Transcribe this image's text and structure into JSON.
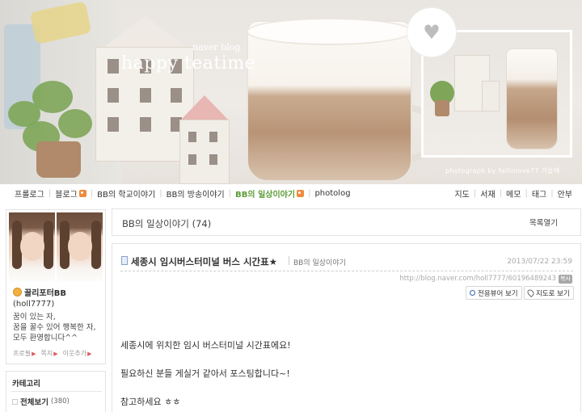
{
  "banner": {
    "subtitle": "naver blog",
    "title": "happy teatime",
    "photo_credit": "photograph by fallinlove77.가을애",
    "heart_icon": "heart-icon"
  },
  "nav": {
    "left": [
      {
        "label": "프롤로그",
        "rss": false,
        "active": false
      },
      {
        "label": "블로그",
        "rss": true,
        "active": false
      },
      {
        "label": "BB의 학교이야기",
        "rss": false,
        "active": false
      },
      {
        "label": "BB의 방송이야기",
        "rss": false,
        "active": false
      },
      {
        "label": "BB의 일상이야기",
        "rss": true,
        "active": true
      },
      {
        "label": "photolog",
        "rss": false,
        "active": false
      }
    ],
    "right": [
      "지도",
      "서재",
      "메모",
      "태그",
      "안부"
    ]
  },
  "profile": {
    "nickname": "꿀리포터BB",
    "user_id": "(holl7777)",
    "intro_line1": "꿈이 있는 자,",
    "intro_line2": "꿈을 꿀수 있어 행복한 자,",
    "intro_line3": "모두 환영합니다^^",
    "links": [
      "프로필",
      "쪽지",
      "이웃추가"
    ]
  },
  "category": {
    "title": "카테고리",
    "all_label": "전체보기",
    "all_count": "(380)"
  },
  "main": {
    "category_title": "BB의 일상이야기",
    "category_count": "(74)",
    "list_toggle": "목록열기"
  },
  "post": {
    "title": "세종시 임시버스터미널 버스 시간표★",
    "category": "BB의 일상이야기",
    "date": "2013/07/22 23:59",
    "url": "http://blog.naver.com/holl7777/60196489243",
    "copy_label": "복사",
    "viewer_button": "전용뷰어 보기",
    "map_button": "지도로 보기",
    "body": [
      "세종시에 위치한 임시 버스터미널 시간표에요!",
      "필요하신 분들 게실거 같아서 포스팅합니다~!",
      "참고하세요 ㅎㅎ"
    ]
  },
  "colors": {
    "accent_green": "#5c9b37",
    "rss_orange": "#f08a3c",
    "border": "#e3e3e3"
  }
}
